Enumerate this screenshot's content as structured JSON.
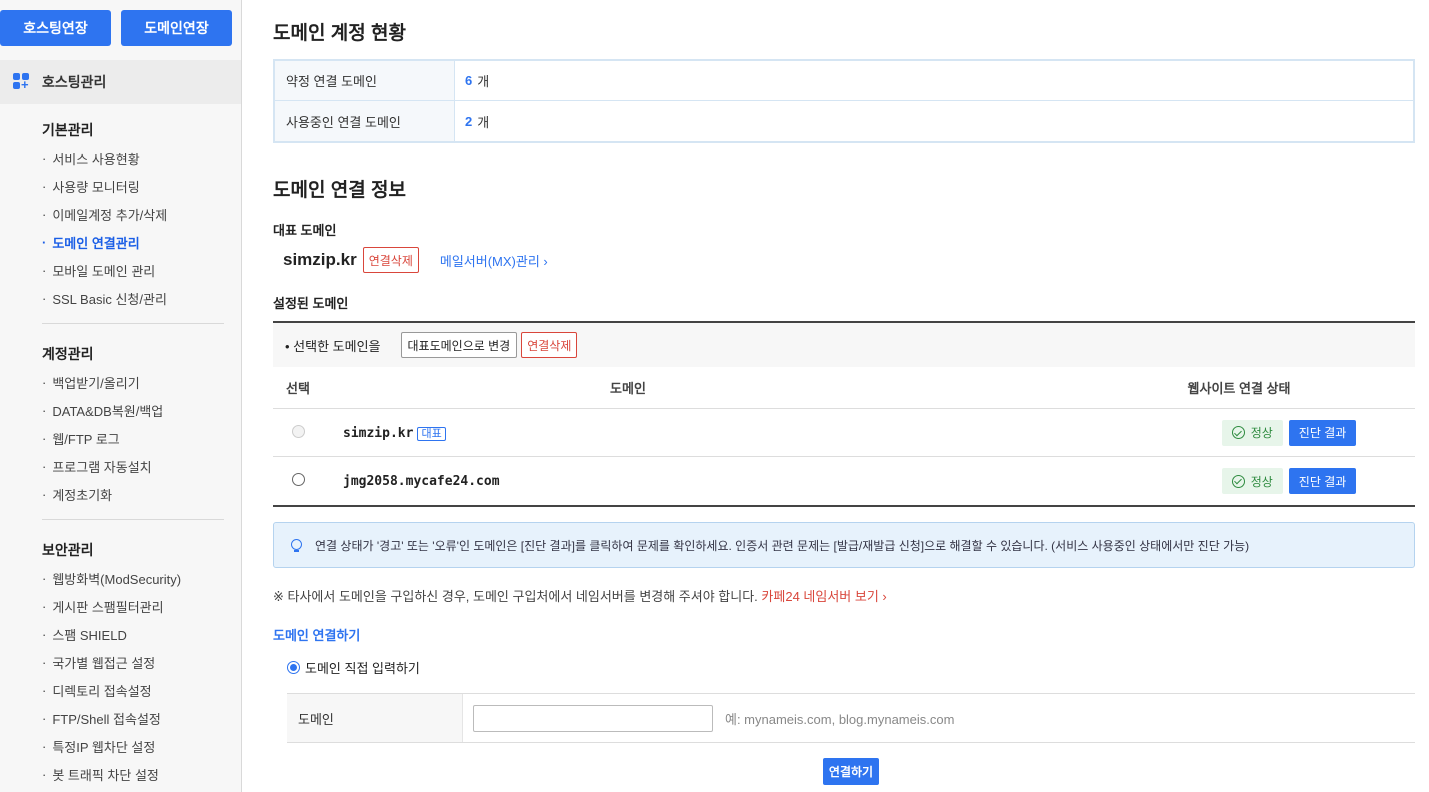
{
  "sidebar": {
    "buttons": [
      "호스팅연장",
      "도메인연장"
    ],
    "header": "호스팅관리",
    "groups": [
      {
        "title": "기본관리",
        "items": [
          "서비스 사용현황",
          "사용량 모니터링",
          "이메일계정 추가/삭제",
          "도메인 연결관리",
          "모바일 도메인 관리",
          "SSL Basic 신청/관리"
        ]
      },
      {
        "title": "계정관리",
        "items": [
          "백업받기/올리기",
          "DATA&DB복원/백업",
          "웹/FTP 로그",
          "프로그램 자동설치",
          "계정초기화"
        ]
      },
      {
        "title": "보안관리",
        "items": [
          "웹방화벽(ModSecurity)",
          "게시판 스팸필터관리",
          "스팸 SHIELD",
          "국가별 웹접근 설정",
          "디렉토리 접속설정",
          "FTP/Shell 접속설정",
          "특정IP 웹차단 설정",
          "봇 트래픽 차단 설정"
        ]
      }
    ],
    "active_item": "도메인 연결관리"
  },
  "main": {
    "status_title": "도메인 계정 현황",
    "summary": [
      {
        "label": "약정 연결 도메인",
        "count": "6",
        "unit": "개"
      },
      {
        "label": "사용중인 연결 도메인",
        "count": "2",
        "unit": "개"
      }
    ],
    "info_title": "도메인 연결 정보",
    "rep_title": "대표 도메인",
    "rep_domain": "simzip.kr",
    "rep_delete": "연결삭제",
    "mx_link": "메일서버(MX)관리 ›",
    "set_title": "설정된 도메인",
    "toolbar_label": "• 선택한 도메인을",
    "toolbar_change": "대표도메인으로 변경",
    "toolbar_delete": "연결삭제",
    "columns": {
      "select": "선택",
      "domain": "도메인",
      "status": "웹사이트 연결 상태"
    },
    "rows": [
      {
        "domain": "simzip.kr",
        "tag": "대표",
        "status": "정상",
        "action": "진단 결과"
      },
      {
        "domain": "jmg2058.mycafe24.com",
        "tag": "",
        "status": "정상",
        "action": "진단 결과"
      }
    ],
    "notice": "연결 상태가 '경고' 또는 '오류'인 도메인은 [진단 결과]를 클릭하여 문제를 확인하세요. 인증서 관련 문제는 [발급/재발급 신청]으로 해결할 수 있습니다. (서비스 사용중인 상태에서만 진단 가능)",
    "note_text": "※ 타사에서 도메인을 구입하신 경우, 도메인 구입처에서 네임서버를 변경해 주셔야 합니다.",
    "note_link": "카페24 네임서버 보기 ›",
    "connect_title": "도메인 연결하기",
    "connect_option": "도메인 직접 입력하기",
    "input_label": "도메인",
    "input_value": "",
    "input_hint": "예: mynameis.com, blog.mynameis.com",
    "connect_button": "연결하기"
  }
}
